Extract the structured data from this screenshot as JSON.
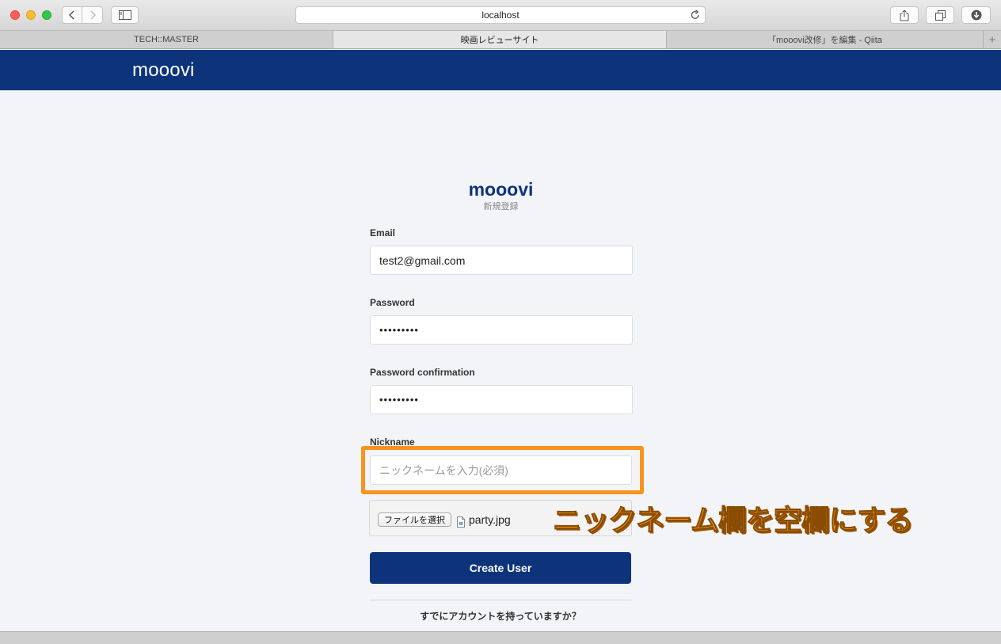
{
  "browser": {
    "url": "localhost",
    "tabs": [
      {
        "label": "TECH::MASTER"
      },
      {
        "label": "映画レビューサイト"
      },
      {
        "label": "「mooovi改修」を編集 - Qiita"
      }
    ],
    "new_tab": "+"
  },
  "site": {
    "logo": "mooovi",
    "header_color": "#0d347b"
  },
  "form": {
    "brand": "mooovi",
    "subtitle": "新規登録",
    "email_label": "Email",
    "email_value": "test2@gmail.com",
    "password_label": "Password",
    "password_value": "•••••••••",
    "password_confirmation_label": "Password confirmation",
    "password_confirmation_value": "•••••••••",
    "nickname_label": "Nickname",
    "nickname_placeholder": "ニックネームを入力(必須)",
    "file_button": "ファイルを選択",
    "file_name": "party.jpg",
    "submit_label": "Create User",
    "already_account": "すでにアカウントを持っていますか？"
  },
  "annotation": {
    "text": "ニックネーム欄を空欄にする",
    "color": "#f7931e"
  }
}
